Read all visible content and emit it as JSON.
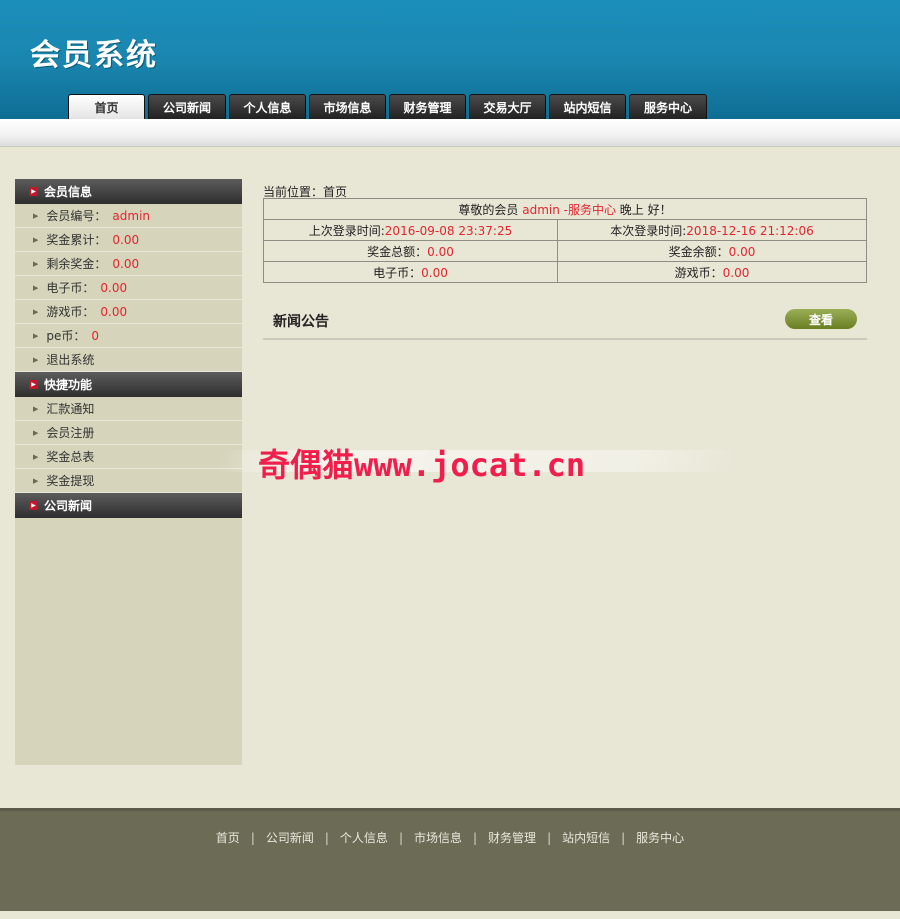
{
  "header": {
    "logo": "会员系统"
  },
  "nav": {
    "tabs": [
      {
        "label": "首页",
        "active": true
      },
      {
        "label": "公司新闻",
        "active": false
      },
      {
        "label": "个人信息",
        "active": false
      },
      {
        "label": "市场信息",
        "active": false
      },
      {
        "label": "财务管理",
        "active": false
      },
      {
        "label": "交易大厅",
        "active": false
      },
      {
        "label": "站内短信",
        "active": false
      },
      {
        "label": "服务中心",
        "active": false
      }
    ]
  },
  "sidebar": {
    "member_info": {
      "title": "会员信息",
      "items": [
        {
          "label": "会员编号：",
          "value": "admin"
        },
        {
          "label": "奖金累计：",
          "value": "0.00"
        },
        {
          "label": "剩余奖金：",
          "value": "0.00"
        },
        {
          "label": "电子币：",
          "value": "0.00"
        },
        {
          "label": "游戏币：",
          "value": "0.00"
        },
        {
          "label": "pe币：",
          "value": "0"
        }
      ],
      "logout": "退出系统"
    },
    "quick": {
      "title": "快捷功能",
      "items": [
        "汇款通知",
        "会员注册",
        "奖金总表",
        "奖金提现"
      ]
    },
    "news": {
      "title": "公司新闻"
    }
  },
  "main": {
    "breadcrumb": "当前位置：首页",
    "greeting": {
      "prefix": "尊敬的会员 ",
      "user": "admin -服务中心",
      "suffix": " 晚上 好！"
    },
    "last_login_label": "上次登录时间:",
    "last_login_value": "2016-09-08 23:37:25",
    "this_login_label": "本次登录时间:",
    "this_login_value": "2018-12-16 21:12:06",
    "bonus_total_label": "奖金总额：",
    "bonus_total_value": "0.00",
    "bonus_balance_label": "奖金余额：",
    "bonus_balance_value": "0.00",
    "ecoin_label": "电子币：",
    "ecoin_value": "0.00",
    "gamecoin_label": "游戏币：",
    "gamecoin_value": "0.00",
    "news_title": "新闻公告",
    "view_button": "查看"
  },
  "watermark": "奇偶猫www.jocat.cn",
  "footer": {
    "links": [
      "首页",
      "公司新闻",
      "个人信息",
      "市场信息",
      "财务管理",
      "站内短信",
      "服务中心"
    ],
    "separator": "|"
  }
}
